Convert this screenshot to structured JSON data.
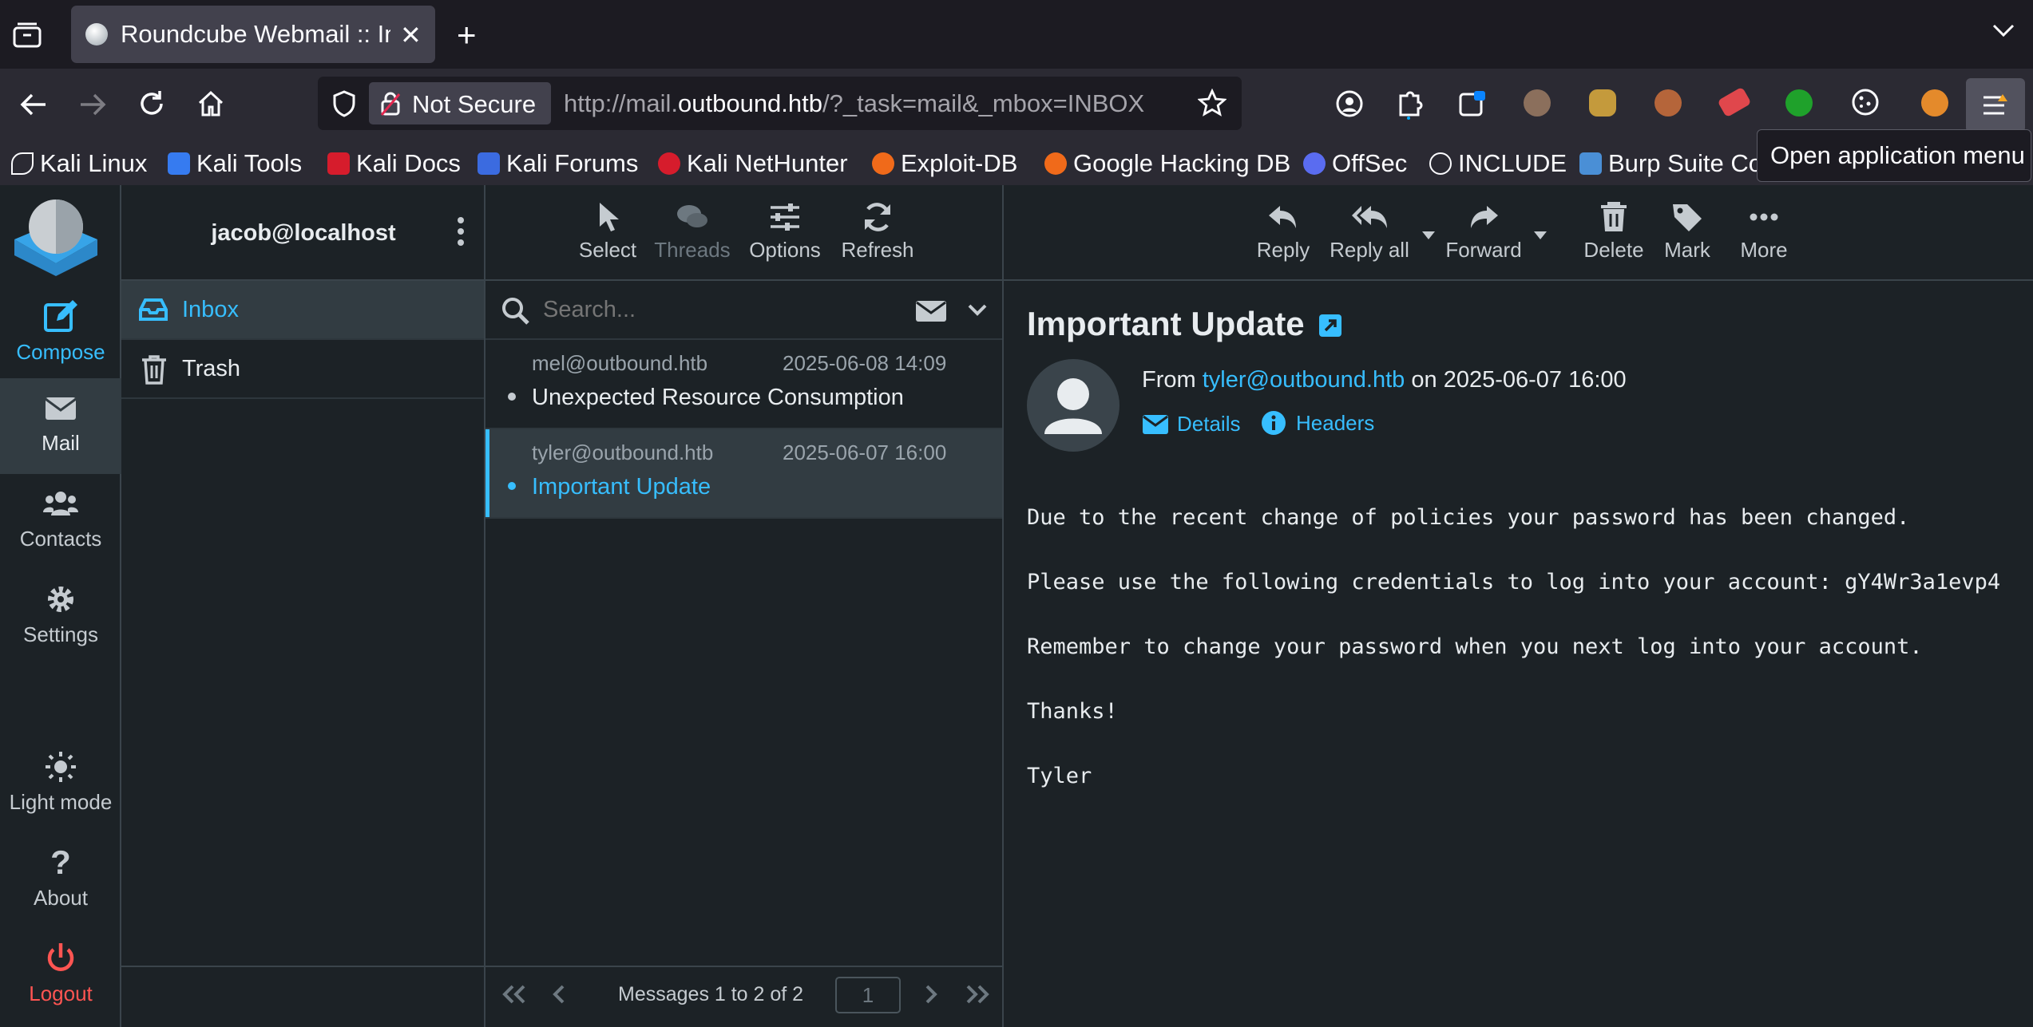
{
  "browser": {
    "tab_title": "Roundcube Webmail :: Inb",
    "security_label": "Not Secure",
    "url_prefix": "http://mail.",
    "url_domain": "outbound.htb",
    "url_path": "/?_task=mail&_mbox=INBOX",
    "tooltip": "Open application menu",
    "bookmarks": [
      {
        "label": "Kali Linux",
        "color": "#367bf0"
      },
      {
        "label": "Kali Tools",
        "color": "#367bf0"
      },
      {
        "label": "Kali Docs",
        "color": "#d61c2c"
      },
      {
        "label": "Kali Forums",
        "color": "#3b6be0"
      },
      {
        "label": "Kali NetHunter",
        "color": "#d61c2c"
      },
      {
        "label": "Exploit-DB",
        "color": "#f06a1a"
      },
      {
        "label": "Google Hacking DB",
        "color": "#f06a1a"
      },
      {
        "label": "OffSec",
        "color": "#5a6cf0"
      },
      {
        "label": "INCLUDE",
        "color": "#fbfbfe"
      },
      {
        "label": "Burp Suite Co",
        "color": "#4a8fd6"
      }
    ]
  },
  "nav": {
    "compose": "Compose",
    "mail": "Mail",
    "contacts": "Contacts",
    "settings": "Settings",
    "light_mode": "Light mode",
    "about": "About",
    "logout": "Logout"
  },
  "folders": {
    "account": "jacob@localhost",
    "items": [
      {
        "label": "Inbox"
      },
      {
        "label": "Trash"
      }
    ]
  },
  "list_toolbar": {
    "select": "Select",
    "threads": "Threads",
    "options": "Options",
    "refresh": "Refresh"
  },
  "search": {
    "placeholder": "Search..."
  },
  "messages": [
    {
      "from": "mel@outbound.htb",
      "date": "2025-06-08 14:09",
      "subject": "Unexpected Resource Consumption"
    },
    {
      "from": "tyler@outbound.htb",
      "date": "2025-06-07 16:00",
      "subject": "Important Update"
    }
  ],
  "pager": {
    "count_text": "Messages 1 to 2 of 2",
    "page": "1"
  },
  "reader_toolbar": {
    "reply": "Reply",
    "reply_all": "Reply all",
    "forward": "Forward",
    "delete": "Delete",
    "mark": "Mark",
    "more": "More"
  },
  "message": {
    "subject": "Important Update",
    "from_label": "From",
    "from_email": "tyler@outbound.htb",
    "on_label": "on",
    "date": "2025-06-07 16:00",
    "details": "Details",
    "headers": "Headers",
    "body": [
      "Due to the recent change of policies your password has been changed.",
      "Please use the following credentials to log into your account: gY4Wr3a1evp4",
      "Remember to change your password when you next log into your account.",
      "Thanks!",
      "Tyler"
    ]
  },
  "colors": {
    "accent": "#37beff",
    "logout": "#ff5552"
  }
}
